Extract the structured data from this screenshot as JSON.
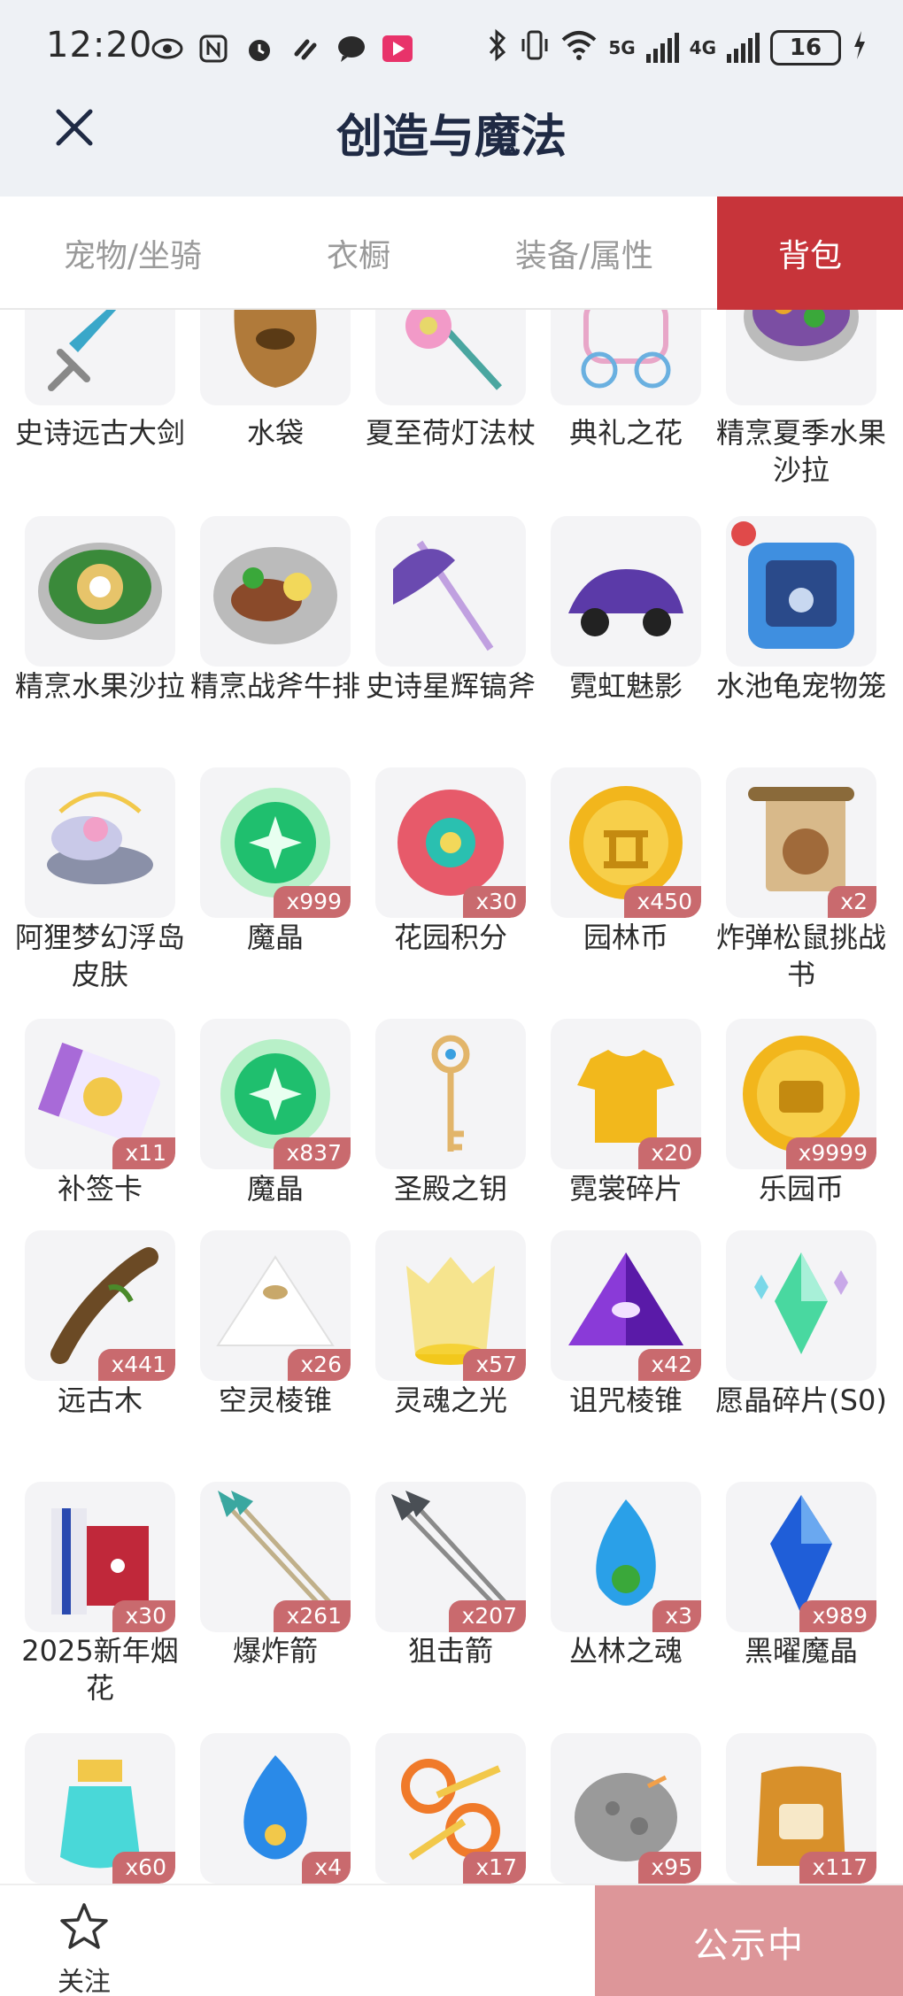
{
  "status_bar": {
    "time": "12:20",
    "net1": "5G",
    "net2": "4G",
    "battery": "16"
  },
  "header": {
    "title": "创造与魔法"
  },
  "tabs": [
    {
      "label": "宠物/坐骑"
    },
    {
      "label": "衣橱"
    },
    {
      "label": "装备/属性"
    },
    {
      "label": "背包"
    }
  ],
  "items": [
    {
      "name": "史诗远古大剑",
      "qty": "",
      "icon": "sword",
      "color": "#3aa7c9"
    },
    {
      "name": "水袋",
      "qty": "",
      "icon": "water-bag",
      "color": "#b07a3a"
    },
    {
      "name": "夏至荷灯法杖",
      "qty": "",
      "icon": "staff",
      "color": "#e7d86a"
    },
    {
      "name": "典礼之花",
      "qty": "",
      "icon": "carriage",
      "color": "#e8a6c8"
    },
    {
      "name": "精烹夏季水果沙拉",
      "qty": "",
      "icon": "fruit-salad",
      "color": "#7b4ea3"
    },
    {
      "name": "精烹水果沙拉",
      "qty": "",
      "icon": "salad",
      "color": "#e7c46a"
    },
    {
      "name": "精烹战斧牛排",
      "qty": "",
      "icon": "steak",
      "color": "#8a4a2a"
    },
    {
      "name": "史诗星辉镐斧",
      "qty": "",
      "icon": "pickaxe",
      "color": "#6a4ab0"
    },
    {
      "name": "霓虹魅影",
      "qty": "",
      "icon": "car",
      "color": "#5b3aa8"
    },
    {
      "name": "水池龟宠物笼",
      "qty": "",
      "icon": "pet-cage",
      "color": "#3f8fe0"
    },
    {
      "name": "阿狸梦幻浮岛皮肤",
      "qty": "",
      "icon": "island",
      "color": "#c9c9e8"
    },
    {
      "name": "魔晶",
      "qty": "x999",
      "icon": "gem-green",
      "color": "#1fbf6e"
    },
    {
      "name": "花园积分",
      "qty": "x30",
      "icon": "flower",
      "color": "#e75a6a"
    },
    {
      "name": "园林币",
      "qty": "x450",
      "icon": "coin",
      "color": "#f2b61c"
    },
    {
      "name": "炸弹松鼠挑战书",
      "qty": "x2",
      "icon": "wanted-scroll",
      "color": "#d8b98a"
    },
    {
      "name": "补签卡",
      "qty": "x11",
      "icon": "ticket",
      "color": "#a86ad8"
    },
    {
      "name": "魔晶",
      "qty": "x837",
      "icon": "gem-green",
      "color": "#1fbf6e"
    },
    {
      "name": "圣殿之钥",
      "qty": "",
      "icon": "key",
      "color": "#e2b56a"
    },
    {
      "name": "霓裳碎片",
      "qty": "x20",
      "icon": "shirt",
      "color": "#f2b81c"
    },
    {
      "name": "乐园币",
      "qty": "x9999",
      "icon": "coin-chest",
      "color": "#f2b61c"
    },
    {
      "name": "远古木",
      "qty": "x441",
      "icon": "wood",
      "color": "#6b4a25"
    },
    {
      "name": "空灵棱锥",
      "qty": "x26",
      "icon": "pyramid-white",
      "color": "#eeeeee"
    },
    {
      "name": "灵魂之光",
      "qty": "x57",
      "icon": "light",
      "color": "#f7d94a"
    },
    {
      "name": "诅咒棱锥",
      "qty": "x42",
      "icon": "pyramid-purple",
      "color": "#8a3ad8"
    },
    {
      "name": "愿晶碎片(S0)",
      "qty": "",
      "icon": "crystal",
      "color": "#49d8a0"
    },
    {
      "name": "2025新年烟花",
      "qty": "x30",
      "icon": "firework",
      "color": "#c0283a"
    },
    {
      "name": "爆炸箭",
      "qty": "x261",
      "icon": "arrows-teal",
      "color": "#3aa7a0"
    },
    {
      "name": "狙击箭",
      "qty": "x207",
      "icon": "arrows-gray",
      "color": "#4a4f55"
    },
    {
      "name": "丛林之魂",
      "qty": "x3",
      "icon": "soul-flame",
      "color": "#2aa0e8"
    },
    {
      "name": "黑曜魔晶",
      "qty": "x989",
      "icon": "blue-crystal",
      "color": "#1f5ed8"
    },
    {
      "name": "",
      "qty": "x60",
      "icon": "potion",
      "color": "#49d8d8"
    },
    {
      "name": "",
      "qty": "x4",
      "icon": "blue-flame",
      "color": "#2a8ae8"
    },
    {
      "name": "",
      "qty": "x17",
      "icon": "scissors",
      "color": "#f07a2a"
    },
    {
      "name": "",
      "qty": "x95",
      "icon": "rock",
      "color": "#9a9a9a"
    },
    {
      "name": "",
      "qty": "x117",
      "icon": "seed-bag",
      "color": "#d8902a"
    }
  ],
  "bottom": {
    "follow_label": "关注",
    "public_label": "公示中"
  }
}
